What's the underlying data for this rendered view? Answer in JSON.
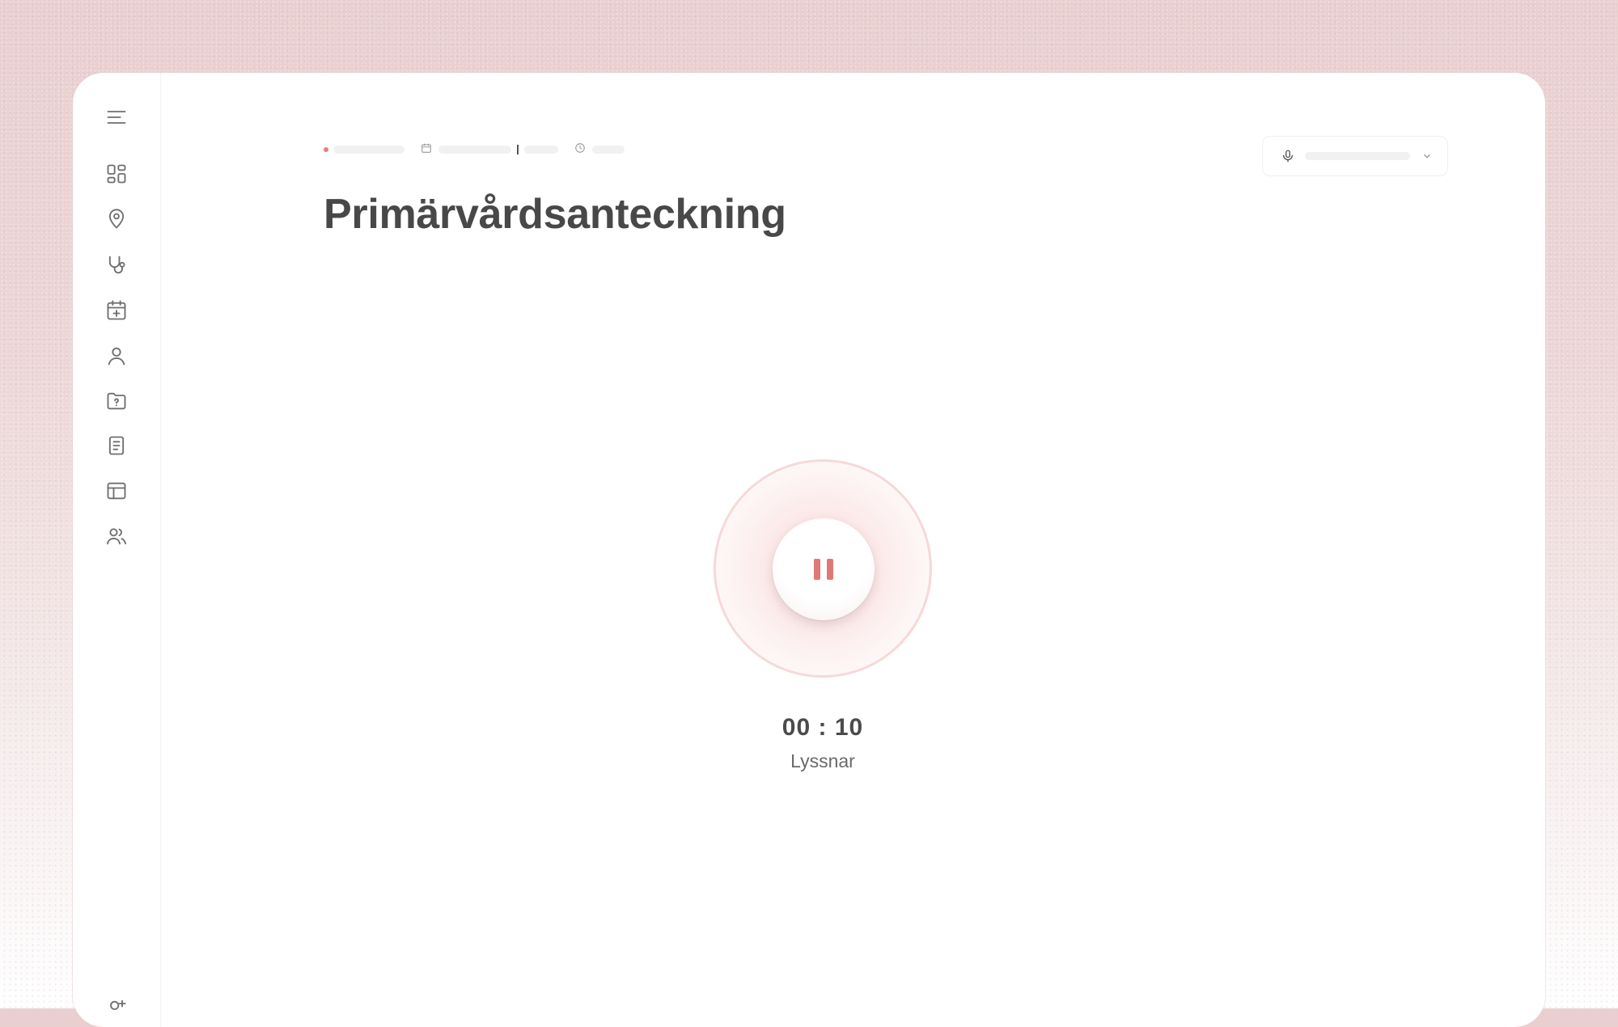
{
  "page": {
    "title": "Primärvårdsanteckning"
  },
  "sidebar": {
    "items": [
      {
        "icon": "menu-icon"
      },
      {
        "icon": "dashboard-icon"
      },
      {
        "icon": "location-pin-icon"
      },
      {
        "icon": "stethoscope-icon"
      },
      {
        "icon": "calendar-add-icon"
      },
      {
        "icon": "user-icon"
      },
      {
        "icon": "folder-help-icon"
      },
      {
        "icon": "document-icon"
      },
      {
        "icon": "table-icon"
      },
      {
        "icon": "users-icon"
      },
      {
        "icon": "account-add-icon"
      }
    ]
  },
  "recording": {
    "timer": "00 : 10",
    "status": "Lyssnar",
    "accent_color": "#e17878"
  },
  "microphone": {
    "icon": "microphone-icon"
  }
}
